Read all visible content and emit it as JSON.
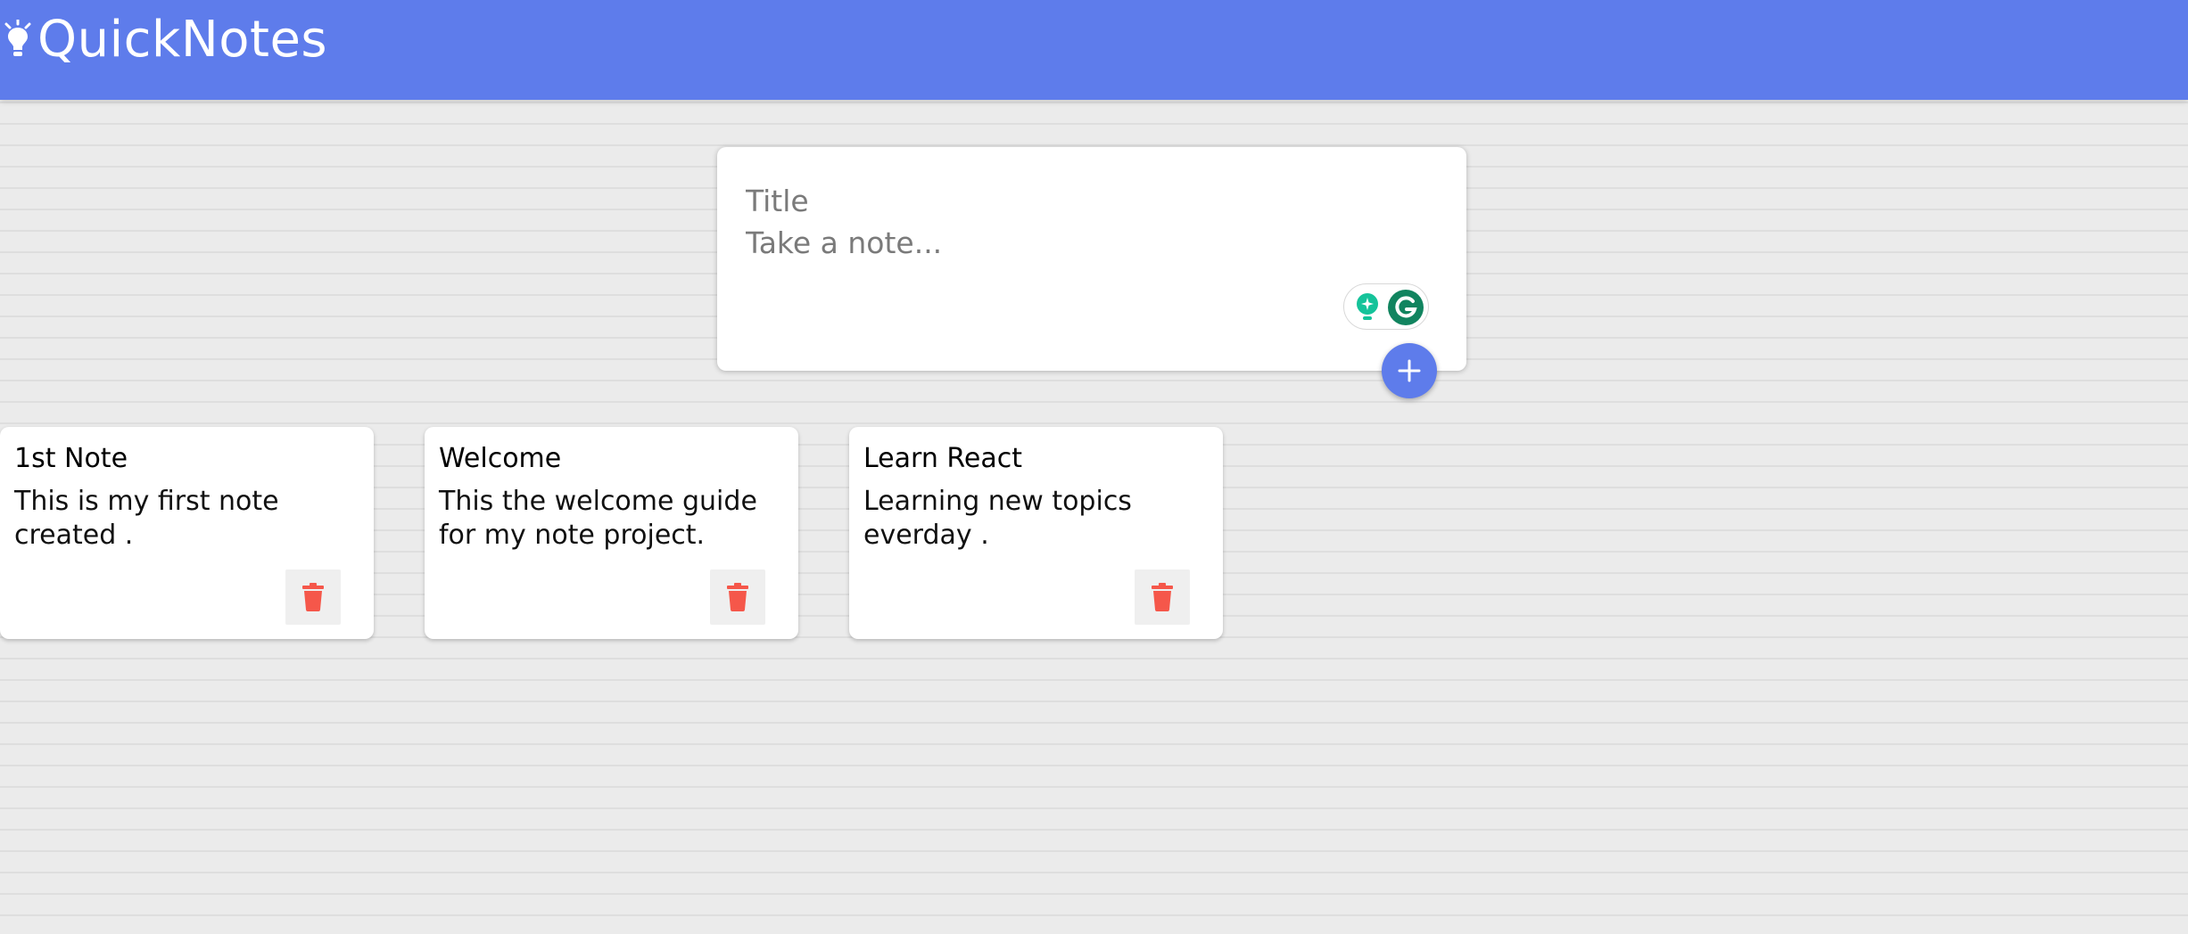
{
  "header": {
    "title": "QuickNotes",
    "icon": "lightbulb-icon",
    "background_color": "#5e7ceb"
  },
  "composer": {
    "title_placeholder": "Title",
    "title_value": "",
    "body_placeholder": "Take a note...",
    "body_value": "",
    "add_icon": "plus-icon",
    "extension_icons": [
      "grammarly-bulb-icon",
      "grammarly-g-icon"
    ]
  },
  "notes": [
    {
      "title": "1st Note",
      "content": "This is my first note created .",
      "delete_icon": "trash-icon"
    },
    {
      "title": "Welcome",
      "content": "This the welcome guide for my note project.",
      "delete_icon": "trash-icon"
    },
    {
      "title": "Learn React",
      "content": "Learning new topics everday .",
      "delete_icon": "trash-icon"
    }
  ],
  "colors": {
    "accent": "#5e7ceb",
    "delete": "#f5574a",
    "grammarly": "#15c39a"
  }
}
